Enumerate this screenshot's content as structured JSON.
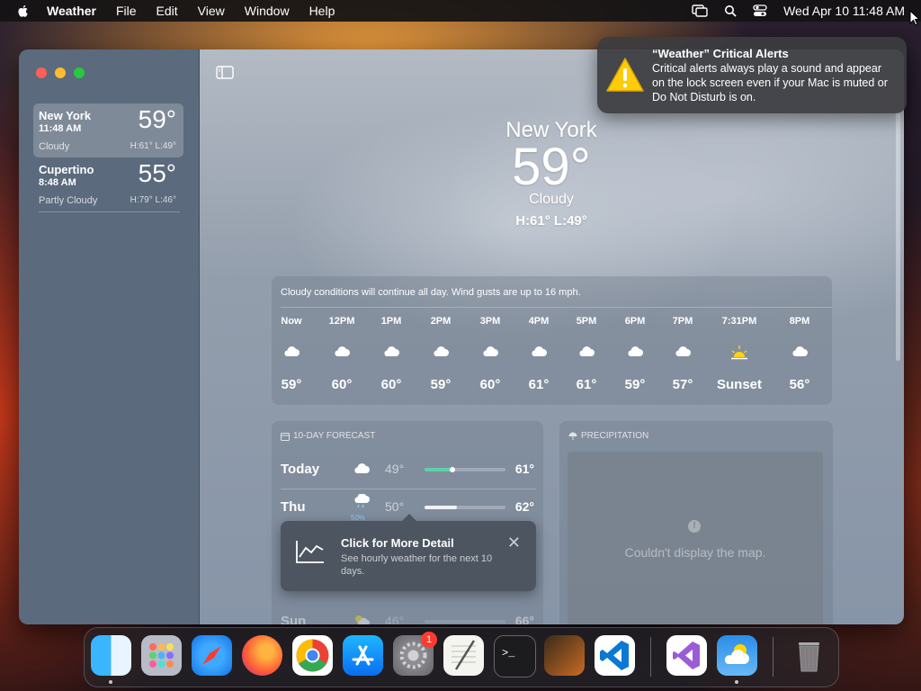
{
  "menubar": {
    "app_name": "Weather",
    "menus": [
      "File",
      "Edit",
      "View",
      "Window",
      "Help"
    ],
    "clock": "Wed Apr 10  11:48 AM"
  },
  "sidebar": {
    "locations": [
      {
        "name": "New York",
        "time": "11:48 AM",
        "temp": "59°",
        "condition": "Cloudy",
        "hilo": "H:61°  L:49°"
      },
      {
        "name": "Cupertino",
        "time": "8:48 AM",
        "temp": "55°",
        "condition": "Partly Cloudy",
        "hilo": "H:79°  L:46°"
      }
    ]
  },
  "hero": {
    "city": "New York",
    "temp": "59°",
    "condition": "Cloudy",
    "hilo": "H:61°  L:49°"
  },
  "hourly": {
    "summary": "Cloudy conditions will continue all day. Wind gusts are up to 16 mph.",
    "hours": [
      {
        "label": "Now",
        "temp": "59°",
        "icon": "cloud-icon"
      },
      {
        "label": "12PM",
        "temp": "60°",
        "icon": "cloud-icon"
      },
      {
        "label": "1PM",
        "temp": "60°",
        "icon": "cloud-icon"
      },
      {
        "label": "2PM",
        "temp": "59°",
        "icon": "cloud-icon"
      },
      {
        "label": "3PM",
        "temp": "60°",
        "icon": "cloud-icon"
      },
      {
        "label": "4PM",
        "temp": "61°",
        "icon": "cloud-icon"
      },
      {
        "label": "5PM",
        "temp": "61°",
        "icon": "cloud-icon"
      },
      {
        "label": "6PM",
        "temp": "59°",
        "icon": "cloud-icon"
      },
      {
        "label": "7PM",
        "temp": "57°",
        "icon": "cloud-icon"
      },
      {
        "label": "7:31PM",
        "temp": "Sunset",
        "icon": "sunset-icon"
      },
      {
        "label": "8PM",
        "temp": "56°",
        "icon": "cloud-icon"
      }
    ]
  },
  "forecast": {
    "title": "10-DAY FORECAST",
    "days": [
      {
        "name": "Today",
        "low": "49°",
        "high": "61°",
        "icon": "cloud-icon"
      },
      {
        "name": "Thu",
        "low": "50°",
        "high": "62°",
        "icon": "cloud-rain-icon",
        "precip": "50%"
      },
      {
        "name": "Sun",
        "low": "46°",
        "high": "66°",
        "icon": "partly-sunny-icon"
      }
    ]
  },
  "precipitation": {
    "title": "PRECIPITATION",
    "error": "Couldn't display the map."
  },
  "tooltip": {
    "title": "Click for More Detail",
    "body": "See hourly weather for the next 10 days."
  },
  "notification": {
    "title": "“Weather” Critical Alerts",
    "body": "Critical alerts always play a sound and appear on the lock screen even if your Mac is muted or Do Not Disturb is on."
  },
  "dock": {
    "apps": [
      "Finder",
      "Launchpad",
      "Safari",
      "Firefox",
      "Chrome",
      "App Store",
      "System Settings",
      "TextEdit",
      "Terminal",
      "GarageBand",
      "Visual Studio Code",
      "Visual Studio",
      "Weather",
      "Trash"
    ],
    "settings_badge": "1"
  },
  "colors": {
    "accent_green": "#5bd1a8",
    "precip_blue": "#7ed1ff",
    "badge_red": "#ff3b30"
  }
}
